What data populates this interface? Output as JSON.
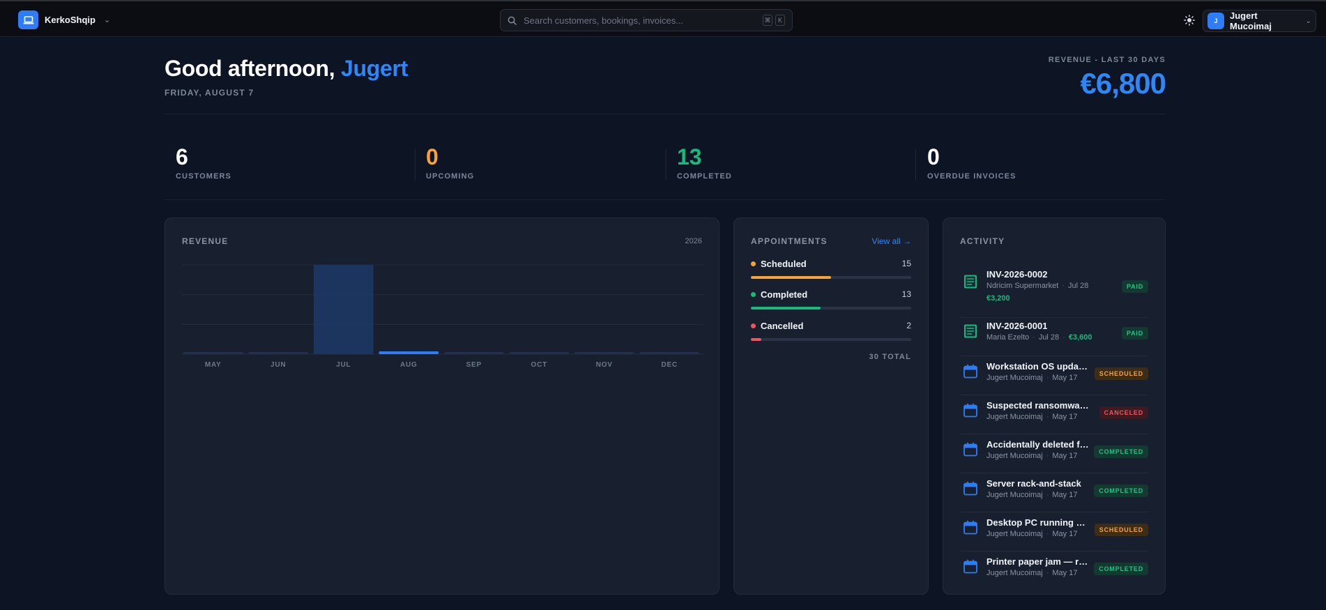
{
  "header": {
    "brand": "KerkoShqip",
    "search_placeholder": "Search customers, bookings, invoices...",
    "kbd_keys": [
      "⌘",
      "K"
    ],
    "user_initial": "J",
    "user_name": "Jugert Mucoimaj"
  },
  "greeting": {
    "prefix": "Good afternoon,",
    "name": "Jugert",
    "date": "FRIDAY, AUGUST 7",
    "revenue_label": "REVENUE - LAST 30 DAYS",
    "revenue_value": "€6,800"
  },
  "stats": [
    {
      "value": "6",
      "label": "CUSTOMERS",
      "color": "#ffffff"
    },
    {
      "value": "0",
      "label": "UPCOMING",
      "color": "#f5a238"
    },
    {
      "value": "13",
      "label": "COMPLETED",
      "color": "#18b97a"
    },
    {
      "value": "0",
      "label": "OVERDUE INVOICES",
      "color": "#ffffff"
    }
  ],
  "revenue_card": {
    "title": "REVENUE",
    "year": "2026"
  },
  "chart_data": {
    "type": "bar",
    "categories": [
      "MAY",
      "JUN",
      "JUL",
      "AUG",
      "SEP",
      "OCT",
      "NOV",
      "DEC"
    ],
    "values": [
      0,
      0,
      6800,
      0,
      0,
      0,
      0,
      0
    ],
    "highlight": "AUG",
    "title": "REVENUE",
    "xlabel": "",
    "ylabel": "",
    "grid": true
  },
  "appointments": {
    "title": "APPOINTMENTS",
    "view_all": "View all →",
    "rows": [
      {
        "label": "Scheduled",
        "count": "15",
        "color": "#f5a238",
        "fraction": 0.5
      },
      {
        "label": "Completed",
        "count": "13",
        "color": "#18b97a",
        "fraction": 0.433
      },
      {
        "label": "Cancelled",
        "count": "2",
        "color": "#f0555d",
        "fraction": 0.067
      }
    ],
    "total": "30 TOTAL"
  },
  "activity": {
    "title": "ACTIVITY",
    "items": [
      {
        "icon": "receipt-icon",
        "title": "INV-2026-0002",
        "who": "Ndricim Supermarket",
        "date": "Jul 28",
        "amount": "€3,200",
        "status": "PAID",
        "kind": "paid"
      },
      {
        "icon": "receipt-icon",
        "title": "INV-2026-0001",
        "who": "Maria Ezelto",
        "date": "Jul 28",
        "amount": "€3,600",
        "status": "PAID",
        "kind": "paid"
      },
      {
        "icon": "calendar-icon",
        "title": "Workstation OS update and driver refresh",
        "who": "Jugert Mucoimaj",
        "date": "May 17",
        "status": "SCHEDULED",
        "kind": "sched"
      },
      {
        "icon": "calendar-icon",
        "title": "Suspected ransomware infection on laptop",
        "who": "Jugert Mucoimaj",
        "date": "May 17",
        "status": "CANCELED",
        "kind": "cancel"
      },
      {
        "icon": "calendar-icon",
        "title": "Accidentally deleted files recovery",
        "who": "Jugert Mucoimaj",
        "date": "May 17",
        "status": "COMPLETED",
        "kind": "done"
      },
      {
        "icon": "calendar-icon",
        "title": "Server rack-and-stack",
        "who": "Jugert Mucoimaj",
        "date": "May 17",
        "status": "COMPLETED",
        "kind": "done"
      },
      {
        "icon": "calendar-icon",
        "title": "Desktop PC running slow after update",
        "who": "Jugert Mucoimaj",
        "date": "May 17",
        "status": "SCHEDULED",
        "kind": "sched"
      },
      {
        "icon": "calendar-icon",
        "title": "Printer paper jam — repeated error",
        "who": "Jugert Mucoimaj",
        "date": "May 17",
        "status": "COMPLETED",
        "kind": "done"
      }
    ]
  }
}
